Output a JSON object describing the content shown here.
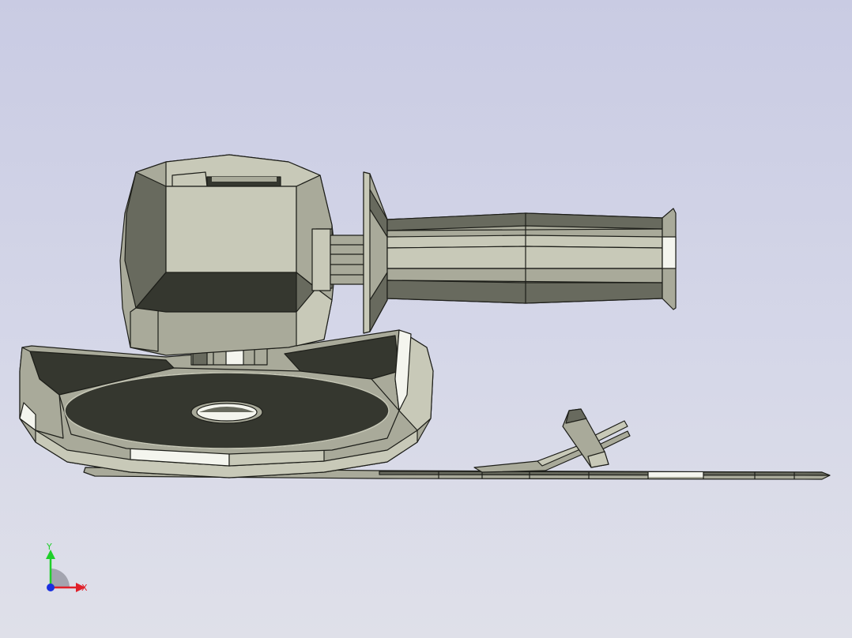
{
  "viewport": {
    "background_top": "#c9cbe3",
    "background_bottom": "#dfe0e9"
  },
  "model": {
    "face_light": "#c8c9b8",
    "face_mid": "#a9aa9a",
    "face_dark": "#686a5e",
    "face_darkest": "#35372f",
    "highlight": "#f4f5ee",
    "edge": "#1d1e19"
  },
  "triad": {
    "x_label": "X",
    "y_label": "Y",
    "x_color": "#e0202a",
    "y_color": "#1fcf2a",
    "z_color": "#1a2fe0"
  }
}
